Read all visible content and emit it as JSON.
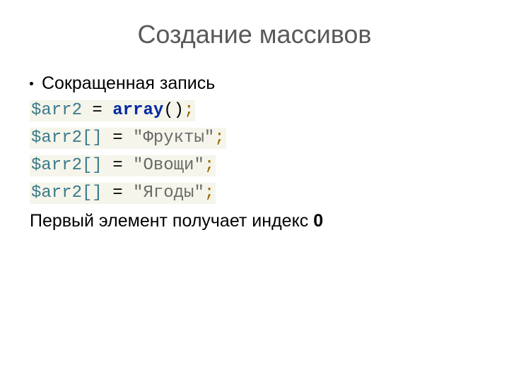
{
  "title": "Создание массивов",
  "bullet": "Сокращенная запись",
  "code": {
    "l1": {
      "var": "$arr2",
      "sp1": " ",
      "op": "=",
      "sp2": " ",
      "kw": "array",
      "paren": "()",
      "semi": ";"
    },
    "l2": {
      "var": "$arr2",
      "brack": "[]",
      "sp1": " ",
      "op": "=",
      "sp2": " ",
      "str": "\"Фрукты\"",
      "semi": ";"
    },
    "l3": {
      "var": "$arr2",
      "brack": "[]",
      "sp1": " ",
      "op": "=",
      "sp2": " ",
      "str": "\"Овощи\"",
      "semi": ";"
    },
    "l4": {
      "var": "$arr2",
      "brack": "[]",
      "sp1": " ",
      "op": "=",
      "sp2": " ",
      "str": "\"Ягоды\"",
      "semi": ";"
    }
  },
  "note_prefix": "Первый элемент получает индекс ",
  "note_index": "0"
}
